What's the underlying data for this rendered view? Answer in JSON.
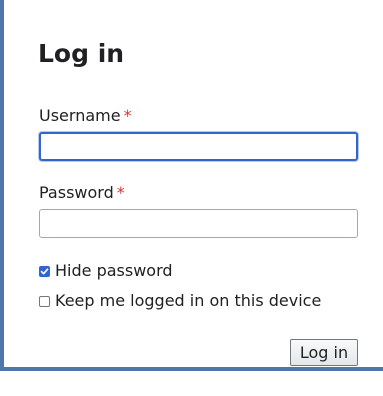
{
  "form": {
    "title": "Log in",
    "username": {
      "label": "Username",
      "required_marker": "*",
      "value": "",
      "placeholder": ""
    },
    "password": {
      "label": "Password",
      "required_marker": "*",
      "value": "",
      "placeholder": ""
    },
    "hide_password": {
      "label": "Hide password",
      "checked": true
    },
    "keep_logged_in": {
      "label": "Keep me logged in on this device",
      "checked": false
    },
    "submit_label": "Log in"
  },
  "colors": {
    "accent": "#3366cc",
    "required": "#dd3333",
    "frame_border": "#4f75ad",
    "text": "#202122"
  },
  "icons": {
    "checkmark": "check-icon"
  }
}
